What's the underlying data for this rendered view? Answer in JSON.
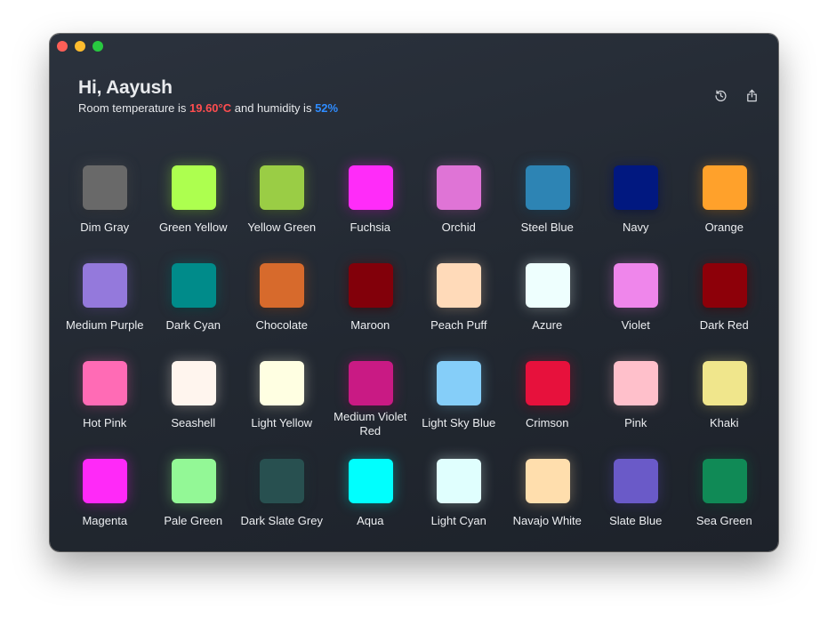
{
  "window": {
    "greeting": "Hi, Aayush",
    "status_prefix": "Room temperature is ",
    "temperature": "19.60°C",
    "status_mid": " and humidity is ",
    "humidity": "52%"
  },
  "toolbar": {
    "icons": [
      "refresh-clock-icon",
      "share-icon"
    ]
  },
  "colors": [
    {
      "name": "Dim Gray",
      "hex": "#696969"
    },
    {
      "name": "Green Yellow",
      "hex": "#adff4f"
    },
    {
      "name": "Yellow Green",
      "hex": "#9acd45"
    },
    {
      "name": "Fuchsia",
      "hex": "#ff2cf9"
    },
    {
      "name": "Orchid",
      "hex": "#df74d6"
    },
    {
      "name": "Steel Blue",
      "hex": "#2d84b4"
    },
    {
      "name": "Navy",
      "hex": "#011880"
    },
    {
      "name": "Orange",
      "hex": "#ffa12b"
    },
    {
      "name": "Medium Purple",
      "hex": "#9479dc"
    },
    {
      "name": "Dark Cyan",
      "hex": "#008b8a"
    },
    {
      "name": "Chocolate",
      "hex": "#d76a2c"
    },
    {
      "name": "Maroon",
      "hex": "#82000a"
    },
    {
      "name": "Peach Puff",
      "hex": "#ffdab9"
    },
    {
      "name": "Azure",
      "hex": "#eefffe"
    },
    {
      "name": "Violet",
      "hex": "#ef86eb"
    },
    {
      "name": "Dark Red",
      "hex": "#8d0009"
    },
    {
      "name": "Hot Pink",
      "hex": "#ff6bb5"
    },
    {
      "name": "Seashell",
      "hex": "#fff5ee"
    },
    {
      "name": "Light Yellow",
      "hex": "#ffffe2"
    },
    {
      "name": "Medium Violet Red",
      "hex": "#c91a84"
    },
    {
      "name": "Light Sky Blue",
      "hex": "#85cef9"
    },
    {
      "name": "Crimson",
      "hex": "#e7113c"
    },
    {
      "name": "Pink",
      "hex": "#ffc0cb"
    },
    {
      "name": "Khaki",
      "hex": "#f0e68c"
    },
    {
      "name": "Magenta",
      "hex": "#ff29f8"
    },
    {
      "name": "Pale Green",
      "hex": "#93f896"
    },
    {
      "name": "Dark Slate Grey",
      "hex": "#285050"
    },
    {
      "name": "Aqua",
      "hex": "#00fffe"
    },
    {
      "name": "Light Cyan",
      "hex": "#e0fffe"
    },
    {
      "name": "Navajo White",
      "hex": "#ffdead"
    },
    {
      "name": "Slate Blue",
      "hex": "#6a5ac8"
    },
    {
      "name": "Sea Green",
      "hex": "#108a56"
    }
  ]
}
